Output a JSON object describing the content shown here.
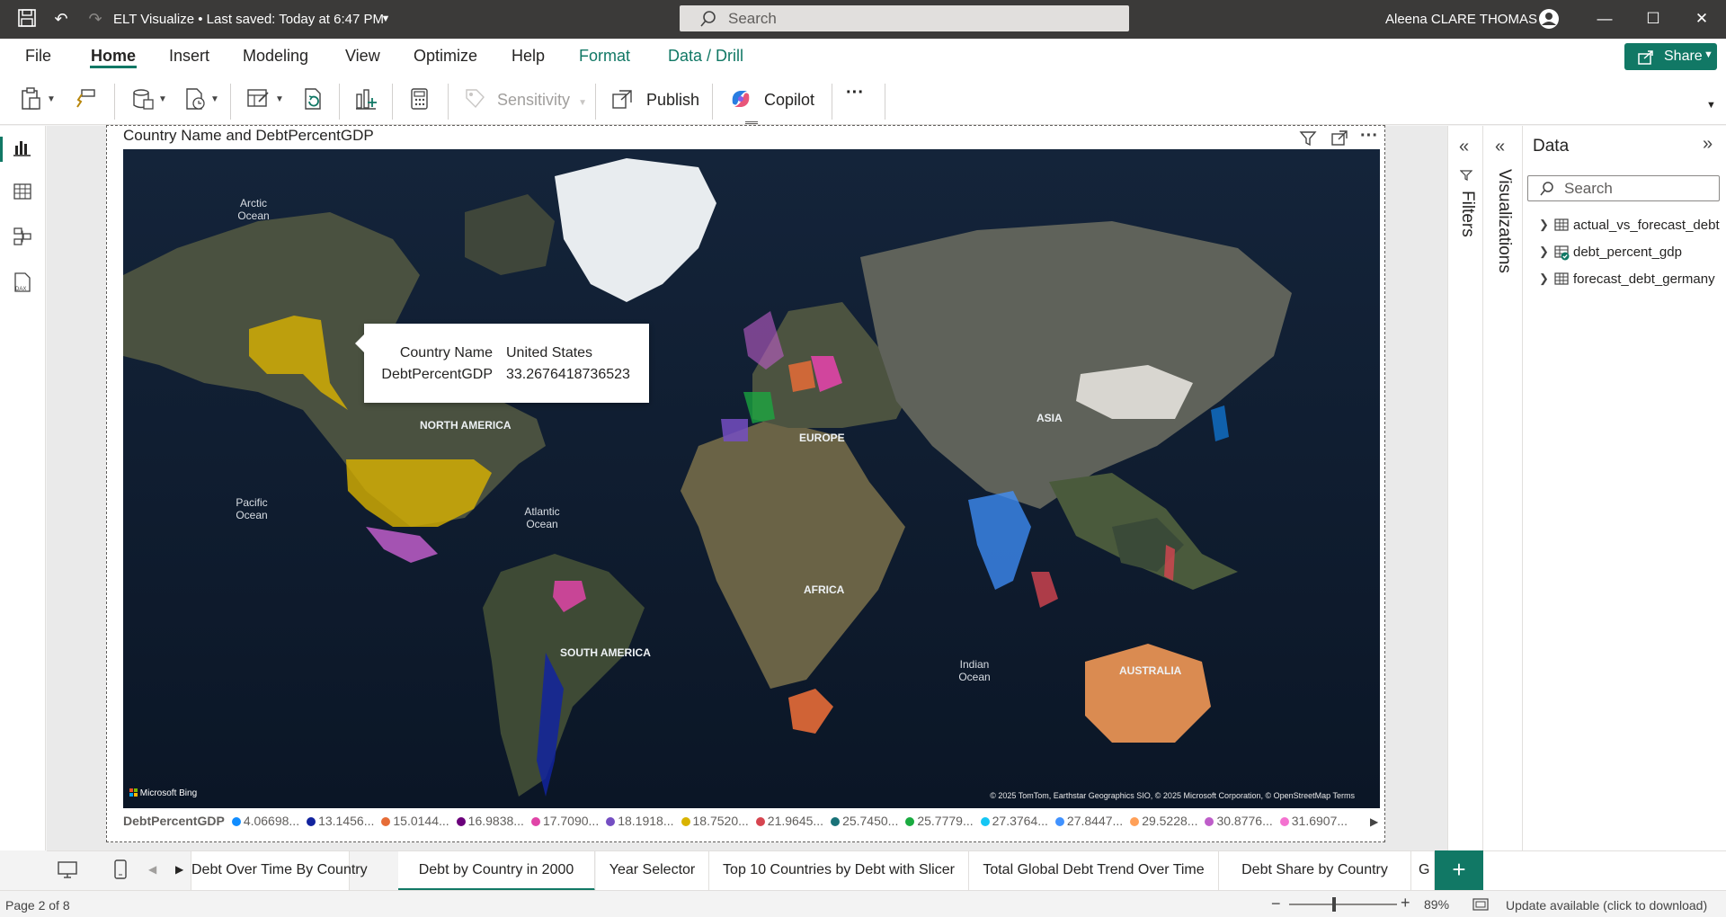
{
  "app": {
    "title": "ELT Visualize • Last saved: Today at 6:47 PM",
    "search_placeholder": "Search",
    "user_name": "Aleena CLARE THOMAS"
  },
  "menu": {
    "items": [
      "File",
      "Home",
      "Insert",
      "Modeling",
      "View",
      "Optimize",
      "Help",
      "Format",
      "Data / Drill"
    ],
    "share_label": "Share"
  },
  "ribbon": {
    "sensitivity_label": "Sensitivity",
    "publish_label": "Publish",
    "copilot_label": "Copilot",
    "more_label": "···"
  },
  "visual": {
    "title": "Country Name and DebtPercentGDP",
    "map_labels": {
      "arctic": "Arctic\nOcean",
      "pacific": "Pacific\nOcean",
      "atlantic": "Atlantic\nOcean",
      "indian": "Indian\nOcean",
      "north_america": "NORTH AMERICA",
      "south_america": "SOUTH AMERICA",
      "europe": "EUROPE",
      "africa": "AFRICA",
      "asia": "ASIA",
      "australia": "AUSTRALIA"
    },
    "attribution": "© 2025 TomTom, Earthstar Geographics SIO, © 2025 Microsoft Corporation, © OpenStreetMap  Terms",
    "bing_label": "Microsoft Bing",
    "tooltip": {
      "key1": "Country Name",
      "val1": "United States",
      "key2": "DebtPercentGDP",
      "val2": "33.2676418736523"
    },
    "legend": {
      "title": "DebtPercentGDP",
      "items": [
        {
          "label": "4.06698...",
          "color": "#118dff"
        },
        {
          "label": "13.1456...",
          "color": "#12239e"
        },
        {
          "label": "15.0144...",
          "color": "#e66c37"
        },
        {
          "label": "16.9838...",
          "color": "#6b007b"
        },
        {
          "label": "17.7090...",
          "color": "#e044a7"
        },
        {
          "label": "18.1918...",
          "color": "#744ec2"
        },
        {
          "label": "18.7520...",
          "color": "#d9b300"
        },
        {
          "label": "21.9645...",
          "color": "#d64550"
        },
        {
          "label": "25.7450...",
          "color": "#197278"
        },
        {
          "label": "25.7779...",
          "color": "#1aab40"
        },
        {
          "label": "27.3764...",
          "color": "#15c6f4"
        },
        {
          "label": "27.8447...",
          "color": "#4092ff"
        },
        {
          "label": "29.5228...",
          "color": "#ffa058"
        },
        {
          "label": "30.8776...",
          "color": "#be5dc9"
        },
        {
          "label": "31.6907...",
          "color": "#f472d0"
        }
      ]
    }
  },
  "panes": {
    "filters_label": "Filters",
    "visualizations_label": "Visualizations",
    "data_title": "Data",
    "data_search_placeholder": "Search",
    "tables": [
      "actual_vs_forecast_debt",
      "debt_percent_gdp",
      "forecast_debt_germany"
    ]
  },
  "pages": {
    "tabs": [
      "Debt Over Time By Country",
      "Debt by Country in 2000",
      "Year Selector",
      "Top 10 Countries by Debt with Slicer",
      "Total Global Debt Trend Over Time",
      "Debt Share by Country",
      "G"
    ],
    "active_index": 1
  },
  "status": {
    "page_indicator": "Page 2 of 8",
    "zoom": "89%",
    "zoom_fraction": 0.89,
    "update_message": "Update available (click to download)"
  }
}
